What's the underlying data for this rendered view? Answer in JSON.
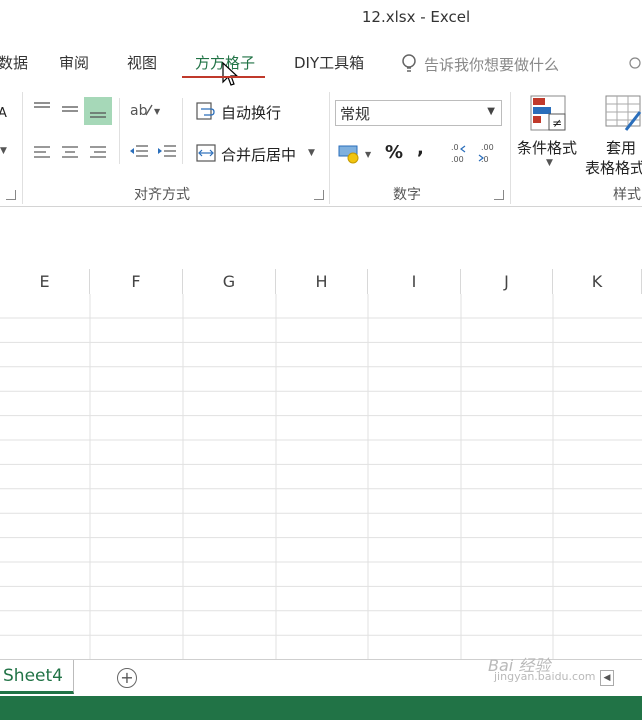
{
  "window": {
    "title": "12.xlsx - Excel"
  },
  "tabs": [
    {
      "label": "数据"
    },
    {
      "label": "审阅"
    },
    {
      "label": "视图"
    },
    {
      "label": "方方格子"
    },
    {
      "label": "DIY工具箱"
    }
  ],
  "tell_me": "告诉我你想要做什么",
  "ribbon": {
    "alignment": {
      "wrap_text": "自动换行",
      "merge_center": "合并后居中",
      "group_label": "对齐方式"
    },
    "number": {
      "format_value": "常规",
      "percent": "%",
      "comma": ",",
      "group_label": "数字"
    },
    "styles": {
      "conditional_format": "条件格式",
      "table_format_line1": "套用",
      "table_format_line2": "表格格式",
      "group_label": "样式"
    }
  },
  "columns": [
    "E",
    "F",
    "G",
    "H",
    "I",
    "J",
    "K"
  ],
  "sheets": [
    {
      "name": "Sheet4"
    }
  ],
  "add_sheet_symbol": "+",
  "watermark": {
    "main": "Bai 经验",
    "sub": "jingyan.baidu.com"
  },
  "colors": {
    "accent": "#217346",
    "tab_underline": "#c0392b",
    "selected_align": "#a6d8b8"
  }
}
